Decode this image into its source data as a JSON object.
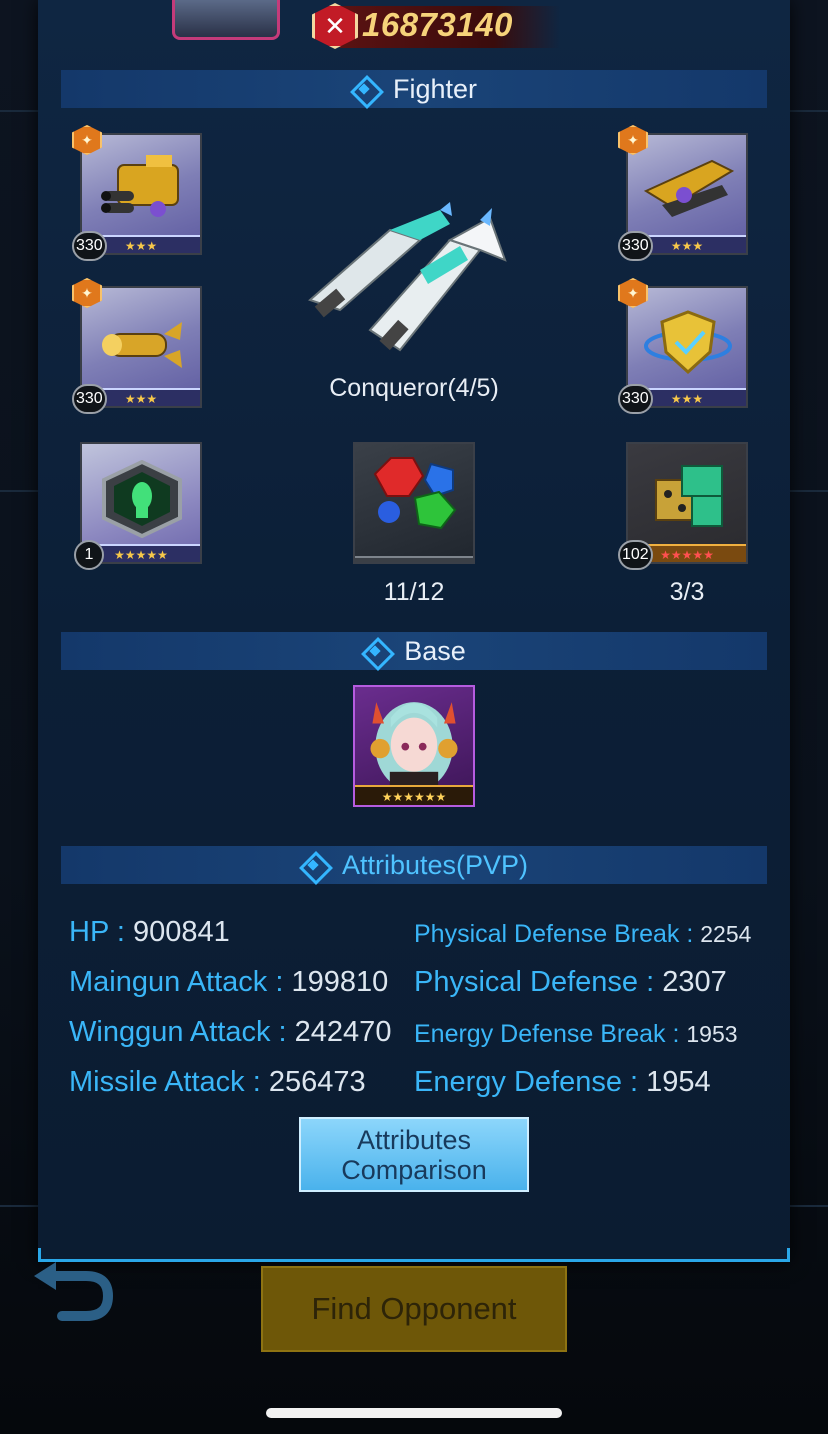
{
  "header": {
    "power_value": "16873140"
  },
  "sections": {
    "fighter_title": "Fighter",
    "base_title": "Base",
    "attributes_title": "Attributes(PVP)"
  },
  "fighter": {
    "name": "Conqueror(4/5)",
    "slots": [
      {
        "level": "330",
        "stars": "★★★"
      },
      {
        "level": "330",
        "stars": "★★★"
      },
      {
        "level": "330",
        "stars": "★★★"
      },
      {
        "level": "330",
        "stars": "★★★"
      },
      {
        "level": "1",
        "stars": "★★★★★"
      },
      {
        "level": "102",
        "stars": "★★★★★"
      }
    ],
    "gems_count": "11/12",
    "module_count": "3/3"
  },
  "base": {
    "portrait_stars": "★★★★★★"
  },
  "attributes": {
    "hp_label": "HP : ",
    "hp_value": "900841",
    "maingun_label": "Maingun Attack : ",
    "maingun_value": "199810",
    "winggun_label": "Winggun Attack : ",
    "winggun_value": "242470",
    "missile_label": "Missile Attack : ",
    "missile_value": "256473",
    "phys_def_break_label": "Physical Defense Break : ",
    "phys_def_break_value": "2254",
    "phys_def_label": "Physical Defense : ",
    "phys_def_value": "2307",
    "energy_def_break_label": "Energy Defense Break : ",
    "energy_def_break_value": "1953",
    "energy_def_label": "Energy Defense : ",
    "energy_def_value": "1954",
    "compare_line1": "Attributes",
    "compare_line2": "Comparison"
  },
  "footer": {
    "find_opponent": "Find Opponent"
  }
}
